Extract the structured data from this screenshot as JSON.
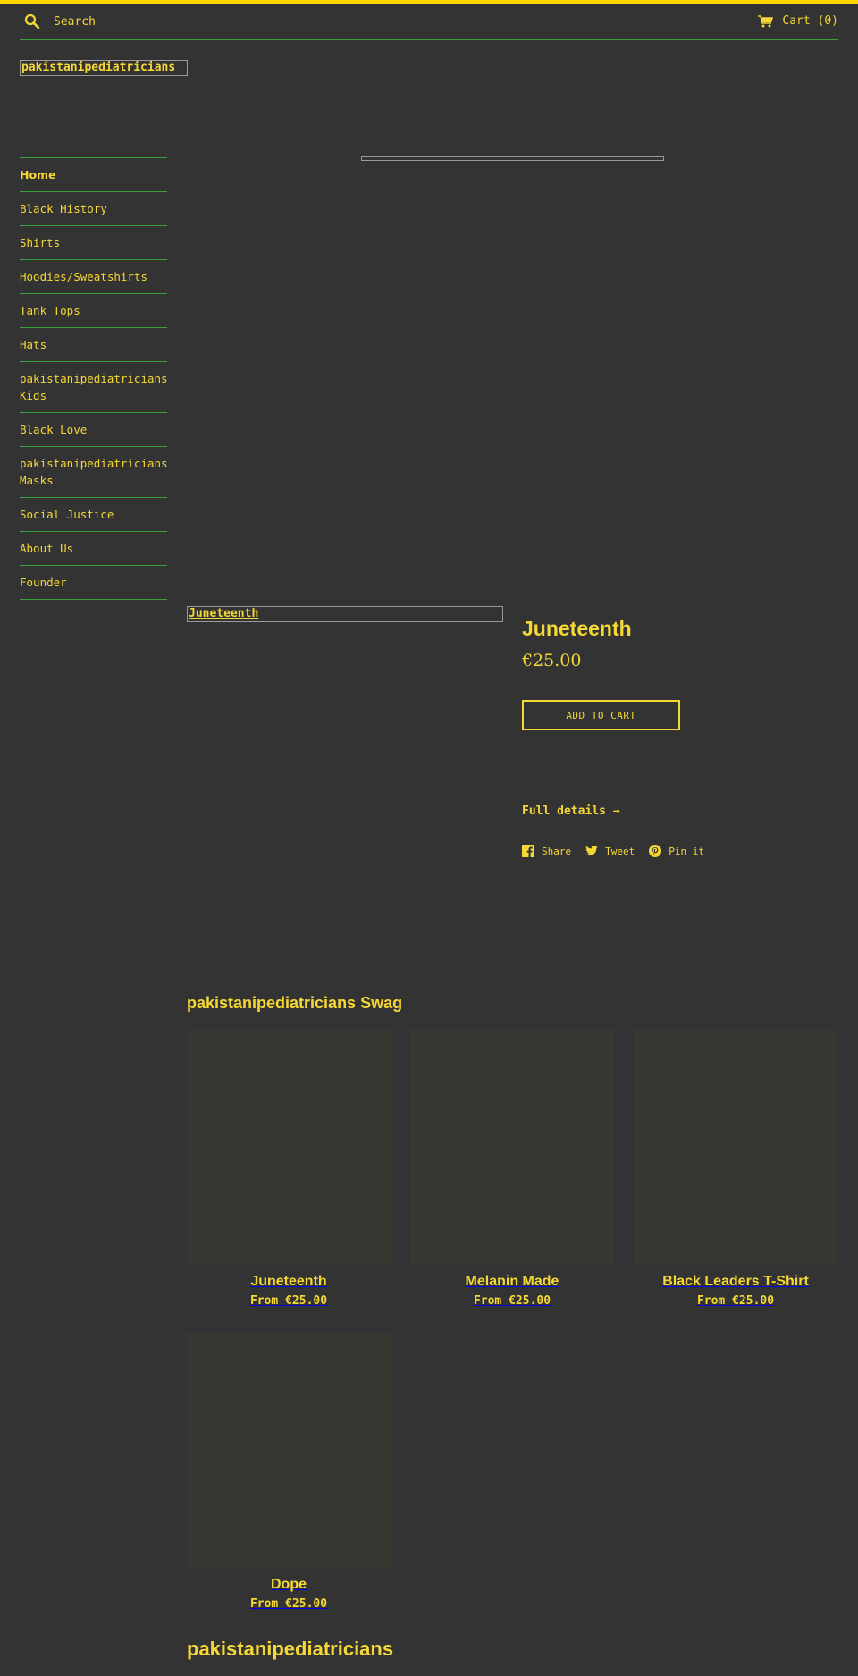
{
  "colors": {
    "accent": "#ffd400",
    "text": "#f5d835",
    "background": "#333333",
    "divider": "#3ba03b"
  },
  "header": {
    "search_placeholder": "Search",
    "search_icon": "search-icon",
    "cart_icon": "cart-icon",
    "cart_label": "Cart (0)"
  },
  "logo": {
    "text": "pakistanipediatricians"
  },
  "sidebar": {
    "items": [
      {
        "label": "Home"
      },
      {
        "label": "Black History"
      },
      {
        "label": "Shirts"
      },
      {
        "label": "Hoodies/Sweatshirts"
      },
      {
        "label": "Tank Tops"
      },
      {
        "label": "Hats"
      },
      {
        "label": "pakistanipediatricians Kids"
      },
      {
        "label": "Black Love"
      },
      {
        "label": "pakistanipediatricians Masks"
      },
      {
        "label": "Social Justice"
      },
      {
        "label": "About Us"
      },
      {
        "label": "Founder"
      }
    ]
  },
  "product": {
    "image_alt": "Juneteenth",
    "title": "Juneteenth",
    "price": "€25.00",
    "add_to_cart": "ADD TO CART",
    "full_details": "Full details →",
    "social": [
      {
        "label": "Share",
        "icon": "facebook-icon"
      },
      {
        "label": "Tweet",
        "icon": "twitter-icon"
      },
      {
        "label": "Pin it",
        "icon": "pinterest-icon"
      }
    ]
  },
  "collection": {
    "title": "pakistanipediatricians Swag",
    "products": [
      {
        "title": "Juneteenth",
        "price": "From €25.00"
      },
      {
        "title": "Melanin Made",
        "price": "From €25.00"
      },
      {
        "title": "Black Leaders T-Shirt",
        "price": "From €25.00"
      },
      {
        "title": "Dope",
        "price": "From €25.00"
      }
    ]
  },
  "footer": {
    "title": "pakistanipediatricians"
  }
}
